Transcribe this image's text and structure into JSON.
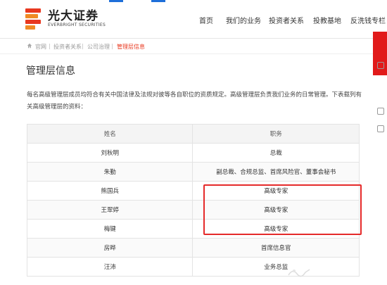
{
  "brand": {
    "name_cn": "光大证券",
    "name_en": "EVERBRIGHT SECURITIES"
  },
  "nav": {
    "items": [
      "首页",
      "我们的业务",
      "投资者关系",
      "投教基地",
      "反洗钱专栏"
    ]
  },
  "breadcrumb": {
    "items": [
      "官网",
      "投资者关系",
      "公司治理",
      "管理层信息"
    ]
  },
  "page": {
    "title": "管理层信息",
    "intro": "每名高级管理层成员均符合有关中国法律及法规对彼等各自职位的资质规定。高级管理层负责我们业务的日常管理。下表载列有关高级管理层的资料："
  },
  "table": {
    "headers": [
      "姓名",
      "职务"
    ],
    "rows": [
      [
        "刘秋明",
        "总裁"
      ],
      [
        "朱勤",
        "副总裁、合规总监、首席风险官、董事会秘书"
      ],
      [
        "熊国兵",
        "高级专家"
      ],
      [
        "王翠婷",
        "高级专家"
      ],
      [
        "梅键",
        "高级专家"
      ],
      [
        "房晔",
        "首席信息官"
      ],
      [
        "汪沛",
        "业务总监"
      ]
    ]
  },
  "colors": {
    "accent": "#e8381f",
    "highlight": "#e52a2a",
    "side_tab": "#e11a1a"
  }
}
